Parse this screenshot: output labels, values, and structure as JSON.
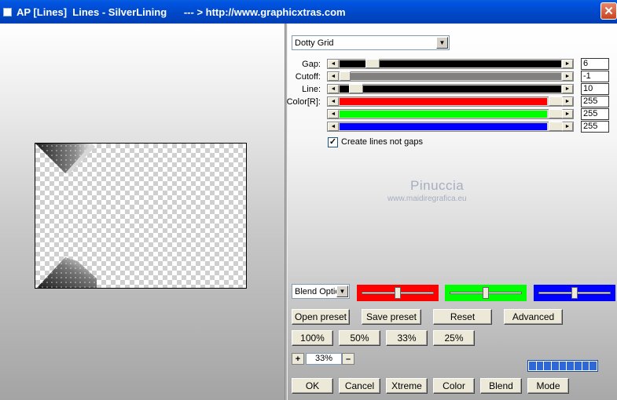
{
  "window": {
    "title": "AP [Lines]  Lines - SilverLining      --- > http://www.graphicxtras.com",
    "close_glyph": "✕"
  },
  "preset_dropdown": {
    "value": "Dotty Grid"
  },
  "params": [
    {
      "label": "Gap:",
      "value": "6",
      "fill": 0.023,
      "color": "#000000"
    },
    {
      "label": "Cutoff:",
      "value": "-1",
      "fill": 0.0,
      "color": "#808080"
    },
    {
      "label": "Line:",
      "value": "10",
      "fill": 0.039,
      "color": "#000000"
    },
    {
      "label": "Color[R]:",
      "value": "255",
      "fill": 1.0,
      "color": "#ff0000"
    },
    {
      "label": "",
      "value": "255",
      "fill": 1.0,
      "color": "#00ff00"
    },
    {
      "label": "",
      "value": "255",
      "fill": 1.0,
      "color": "#0000ff"
    }
  ],
  "checkbox": {
    "label": "Create lines not gaps",
    "checked": true,
    "mark": "✓"
  },
  "watermark": {
    "name": "Pinuccia",
    "url": "www.maidiregrafica.eu"
  },
  "blend_dropdown": {
    "value": "Blend Optio"
  },
  "color_sliders": [
    {
      "color": "#ff0000",
      "position": 0.5
    },
    {
      "color": "#00ff00",
      "position": 0.5
    },
    {
      "color": "#0000ff",
      "position": 0.5
    }
  ],
  "preset_buttons": {
    "open": "Open preset",
    "save": "Save preset",
    "reset": "Reset",
    "advanced": "Advanced"
  },
  "zoom_buttons": [
    "100%",
    "50%",
    "33%",
    "25%"
  ],
  "zoom": {
    "plus": "+",
    "value": "33%",
    "minus": "–"
  },
  "bottom_buttons": [
    "OK",
    "Cancel",
    "Xtreme",
    "Color",
    "Blend",
    "Mode"
  ],
  "progress": {
    "fraction": 1.0,
    "segments": 9
  }
}
